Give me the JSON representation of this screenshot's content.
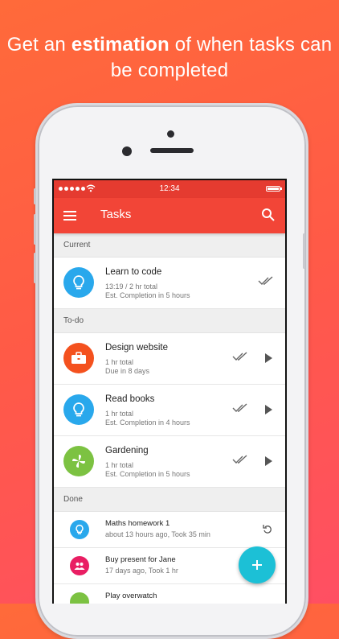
{
  "headline": {
    "pre": "Get an ",
    "bold": "estimation",
    "post": " of when tasks can be completed"
  },
  "status_bar": {
    "time": "12:34"
  },
  "app_bar": {
    "title": "Tasks"
  },
  "sections": {
    "current": "Current",
    "todo": "To-do",
    "done": "Done"
  },
  "current_task": {
    "name": "Learn to code",
    "line1": "13:19 / 2 hr total",
    "line2": "Est. Completion in 5 hours",
    "icon": "lightbulb-icon",
    "color": "#29a8ec"
  },
  "todo_tasks": [
    {
      "name": "Design website",
      "line1": "1 hr total",
      "line2": "Due in 8 days",
      "icon": "briefcase-icon",
      "color": "#f4511e"
    },
    {
      "name": "Read books",
      "line1": "1 hr total",
      "line2": "Est. Completion in 4 hours",
      "icon": "lightbulb-icon",
      "color": "#29a8ec"
    },
    {
      "name": "Gardening",
      "line1": "1 hr total",
      "line2": "Est. Completion in 5 hours",
      "icon": "pinwheel-icon",
      "color": "#7cc242"
    }
  ],
  "done_tasks": [
    {
      "name": "Maths homework 1",
      "line1": "about 13 hours ago, Took 35 min",
      "icon": "lightbulb-icon",
      "color": "#29a8ec"
    },
    {
      "name": "Buy present for Jane",
      "line1": "17 days ago, Took 1 hr",
      "icon": "people-icon",
      "color": "#e91e63"
    },
    {
      "name": "Play overwatch",
      "icon": "game-icon",
      "color": "#7cc242"
    }
  ],
  "colors": {
    "accent": "#f24537",
    "fab": "#1cc0d6"
  }
}
